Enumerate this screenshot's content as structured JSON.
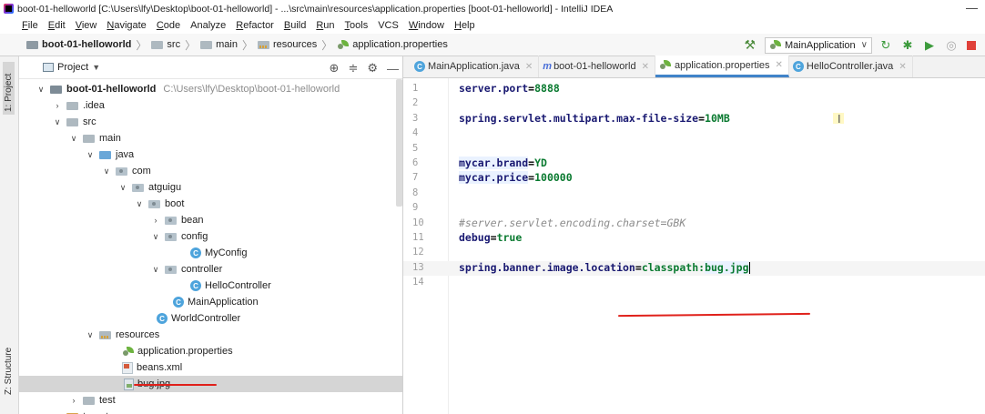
{
  "window": {
    "title": "boot-01-helloworld [C:\\Users\\lfy\\Desktop\\boot-01-helloworld] - ...\\src\\main\\resources\\application.properties [boot-01-helloworld] - IntelliJ IDEA",
    "minimize": "—"
  },
  "menu": [
    {
      "u": "F",
      "rest": "ile"
    },
    {
      "u": "E",
      "rest": "dit"
    },
    {
      "u": "V",
      "rest": "iew"
    },
    {
      "u": "N",
      "rest": "avigate"
    },
    {
      "u": "C",
      "rest": "ode"
    },
    {
      "u": "",
      "rest": "Analyze"
    },
    {
      "u": "R",
      "rest": "efactor"
    },
    {
      "u": "B",
      "rest": "uild"
    },
    {
      "u": "R",
      "rest": "un"
    },
    {
      "u": "T",
      "rest": "ools"
    },
    {
      "u": "",
      "rest": "VCS"
    },
    {
      "u": "W",
      "rest": "indow"
    },
    {
      "u": "H",
      "rest": "elp"
    }
  ],
  "breadcrumb": {
    "project": "boot-01-helloworld",
    "src": "src",
    "main": "main",
    "resources": "resources",
    "file": "application.properties"
  },
  "run_config": {
    "label": "MainApplication"
  },
  "toolstrip": {
    "project": "1: Project",
    "structure": "Z: Structure"
  },
  "project_panel": {
    "title": "Project"
  },
  "tree": {
    "root": "boot-01-helloworld",
    "root_path": "C:\\Users\\lfy\\Desktop\\boot-01-helloworld",
    "idea": ".idea",
    "src": "src",
    "main": "main",
    "java": "java",
    "com": "com",
    "atguigu": "atguigu",
    "boot": "boot",
    "bean": "bean",
    "config": "config",
    "myconfig": "MyConfig",
    "controller": "controller",
    "hellocontroller": "HelloController",
    "mainapplication": "MainApplication",
    "worldcontroller": "WorldController",
    "resources": "resources",
    "app_props": "application.properties",
    "beans_xml": "beans.xml",
    "bug_jpg": "bug.jpg",
    "test": "test",
    "target": "target"
  },
  "tabs": [
    {
      "label": "MainApplication.java"
    },
    {
      "label": "boot-01-helloworld"
    },
    {
      "label": "application.properties"
    },
    {
      "label": "HelloController.java"
    }
  ],
  "code": {
    "l1_key": "server.port",
    "l1_val": "8888",
    "l3_key": "spring.servlet.multipart.max-file-size",
    "l3_val": "10MB",
    "l6_key": "mycar.brand",
    "l6_val": "YD",
    "l7_key": "mycar.price",
    "l7_val": "100000",
    "l10_comment": "#server.servlet.encoding.charset=GBK",
    "l11_key": "debug",
    "l11_val": "true",
    "l13_key": "spring.banner.image.location",
    "l13_val_a": "classpath:",
    "l13_val_b": "bug.jpg",
    "eq": "="
  },
  "line_numbers": [
    "1",
    "2",
    "3",
    "4",
    "5",
    "6",
    "7",
    "8",
    "9",
    "10",
    "11",
    "12",
    "13",
    "14"
  ]
}
